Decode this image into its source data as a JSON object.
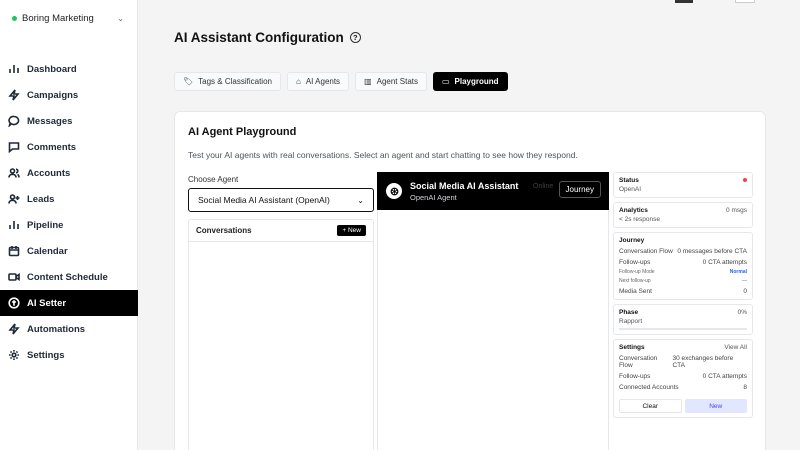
{
  "workspace": {
    "name": "Boring Marketing",
    "status_color": "#22c55e"
  },
  "sidebar": {
    "items": [
      {
        "label": "Dashboard",
        "icon": "bar-chart-icon",
        "active": false
      },
      {
        "label": "Campaigns",
        "icon": "lightning-icon",
        "active": false
      },
      {
        "label": "Messages",
        "icon": "chat-bubble-icon",
        "active": false
      },
      {
        "label": "Comments",
        "icon": "comment-icon",
        "active": false
      },
      {
        "label": "Accounts",
        "icon": "users-icon",
        "active": false
      },
      {
        "label": "Leads",
        "icon": "user-plus-icon",
        "active": false
      },
      {
        "label": "Pipeline",
        "icon": "bar-chart-icon",
        "active": false
      },
      {
        "label": "Calendar",
        "icon": "calendar-icon",
        "active": false
      },
      {
        "label": "Content Schedule",
        "icon": "video-icon",
        "active": false
      },
      {
        "label": "AI Setter",
        "icon": "ai-setter-icon",
        "active": true
      },
      {
        "label": "Automations",
        "icon": "lightning-icon",
        "active": false
      },
      {
        "label": "Settings",
        "icon": "gear-icon",
        "active": false
      }
    ]
  },
  "page": {
    "title": "AI Assistant Configuration"
  },
  "tabs": [
    {
      "label": "Tags & Classification",
      "icon": "tag-icon",
      "active": false
    },
    {
      "label": "AI Agents",
      "icon": "robot-icon",
      "active": false
    },
    {
      "label": "Agent Stats",
      "icon": "stats-icon",
      "active": false
    },
    {
      "label": "Playground",
      "icon": "chat-bubble-icon",
      "active": true
    }
  ],
  "playground": {
    "title": "AI Agent Playground",
    "description": "Test your AI agents with real conversations. Select an agent and start chatting to see how they respond.",
    "choose_label": "Choose Agent",
    "selected_agent": "Social Media AI Assistant (OpenAI)",
    "conversations_label": "Conversations",
    "new_button": "+ New",
    "chat": {
      "agent_name": "Social Media AI Assistant",
      "agent_sub": "OpenAI Agent",
      "online": "Online",
      "journey_button": "Journey"
    }
  },
  "panel": {
    "status": {
      "title": "Status",
      "value": "OpenAI",
      "dot_color": "#ef4444"
    },
    "analytics": {
      "title": "Analytics",
      "value": "< 2s response",
      "count": "0 msgs"
    },
    "journey": {
      "title": "Journey",
      "rows": [
        {
          "label": "Conversation Flow",
          "value": "0 messages before CTA"
        },
        {
          "label": "Follow-ups",
          "value": "0 CTA attempts"
        }
      ],
      "small_rows": [
        {
          "label": "Follow-up Mode",
          "value": "Normal"
        },
        {
          "label": "Next follow-up",
          "value": "—"
        }
      ],
      "media_label": "Media Sent",
      "media_value": "0"
    },
    "phase": {
      "title": "Phase",
      "percent": "0%",
      "value": "Rapport",
      "progress": 0
    },
    "settings": {
      "title": "Settings",
      "view_all": "View All",
      "rows": [
        {
          "label": "Conversation Flow",
          "value": "30 exchanges before CTA"
        },
        {
          "label": "Follow-ups",
          "value": "0 CTA attempts"
        },
        {
          "label": "Connected Accounts",
          "value": "8"
        }
      ],
      "clear_button": "Clear",
      "new_button": "New"
    }
  }
}
